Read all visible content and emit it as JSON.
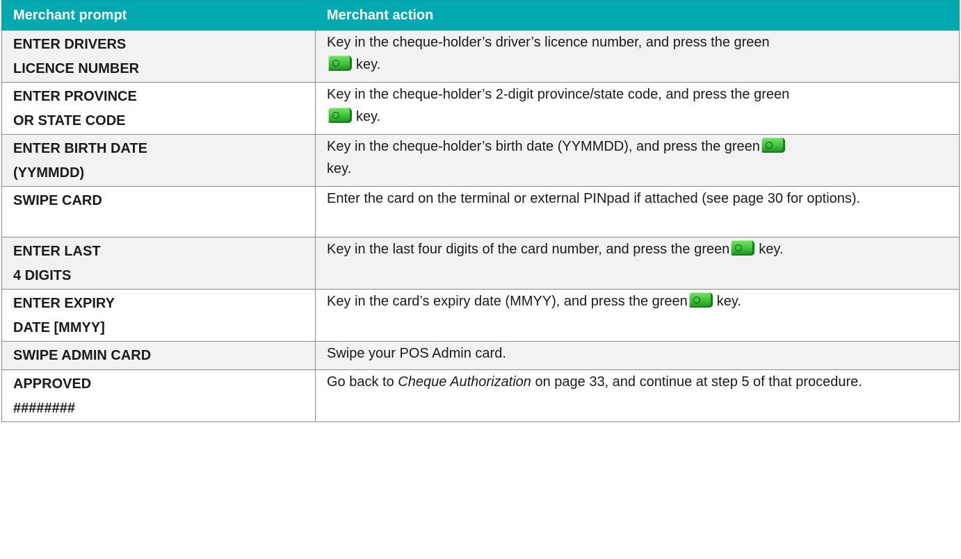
{
  "table": {
    "header": {
      "prompt": "Merchant prompt",
      "action": "Merchant action"
    },
    "rows": [
      {
        "prompt_line1": "ENTER DRIVERS",
        "prompt_line2": "LICENCE NUMBER",
        "action_before": "Key in the cheque-holder’s driver’s licence number, and press the green",
        "action_after": "key."
      },
      {
        "prompt_line1": "ENTER PROVINCE",
        "prompt_line2": "OR STATE CODE",
        "action_before": "Key in the cheque-holder’s 2-digit province/state code, and press the green",
        "action_after": "key."
      },
      {
        "prompt_line1": "ENTER BIRTH DATE",
        "prompt_line2": "(YYMMDD)",
        "action_before": "Key in the cheque-holder’s birth date (YYMMDD), and press the green",
        "action_after": "key."
      },
      {
        "prompt_line1": "SWIPE CARD",
        "action_text": "Enter the card on the terminal or external PINpad if attached (see page 30 for options)."
      },
      {
        "prompt_line1": "ENTER LAST",
        "prompt_line2": "4 DIGITS",
        "action_before": "Key in the last four digits of the card number, and press the green",
        "action_after": "key."
      },
      {
        "prompt_line1": "ENTER EXPIRY",
        "prompt_line2": "DATE [MMYY]",
        "action_before": "Key in the card’s expiry date (MMYY), and press the green",
        "action_after": "key."
      },
      {
        "prompt_line1": "SWIPE ADMIN CARD",
        "action_text": "Swipe your POS Admin card."
      },
      {
        "prompt_line1": "APPROVED",
        "prompt_line2": "########",
        "action_before": "Go back to",
        "action_italic": "Cheque Authorization",
        "action_after": "on page 33, and continue at step 5 of that procedure."
      }
    ]
  },
  "icons": {
    "key": "green-enter-key-icon"
  },
  "colors": {
    "header_bg": "#00a9b0",
    "header_text": "#ffffff",
    "row_alt_bg": "#f2f2f2",
    "key_green": "#3cc23a"
  }
}
